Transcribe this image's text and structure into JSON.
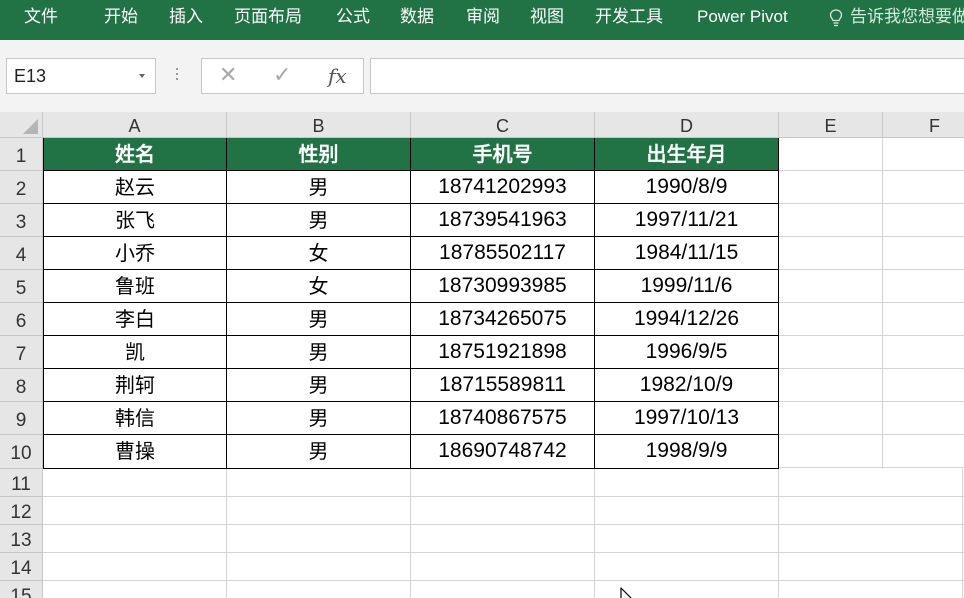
{
  "ribbon": {
    "tabs": [
      "文件",
      "开始",
      "插入",
      "页面布局",
      "公式",
      "数据",
      "审阅",
      "视图",
      "开发工具",
      "Power Pivot"
    ],
    "tell_me": "告诉我您想要做什么"
  },
  "formula_bar": {
    "name_box": "E13",
    "cancel_icon": "✕",
    "enter_icon": "✓",
    "fx_label": "fx",
    "formula": ""
  },
  "columns": [
    "A",
    "B",
    "C",
    "D",
    "E",
    "F"
  ],
  "rows": [
    "1",
    "2",
    "3",
    "4",
    "5",
    "6",
    "7",
    "8",
    "9",
    "10",
    "11",
    "12",
    "13",
    "14",
    "15"
  ],
  "table": {
    "headers": [
      "姓名",
      "性别",
      "手机号",
      "出生年月"
    ],
    "data": [
      [
        "赵云",
        "男",
        "18741202993",
        "1990/8/9"
      ],
      [
        "张飞",
        "男",
        "18739541963",
        "1997/11/21"
      ],
      [
        "小乔",
        "女",
        "18785502117",
        "1984/11/15"
      ],
      [
        "鲁班",
        "女",
        "18730993985",
        "1999/11/6"
      ],
      [
        "李白",
        "男",
        "18734265075",
        "1994/12/26"
      ],
      [
        "凯",
        "男",
        "18751921898",
        "1996/9/5"
      ],
      [
        "荆轲",
        "男",
        "18715589811",
        "1982/10/9"
      ],
      [
        "韩信",
        "男",
        "18740867575",
        "1997/10/13"
      ],
      [
        "曹操",
        "男",
        "18690748742",
        "1998/9/9"
      ]
    ]
  },
  "colors": {
    "excel_green": "#217346",
    "header_text": "#ffffff"
  }
}
